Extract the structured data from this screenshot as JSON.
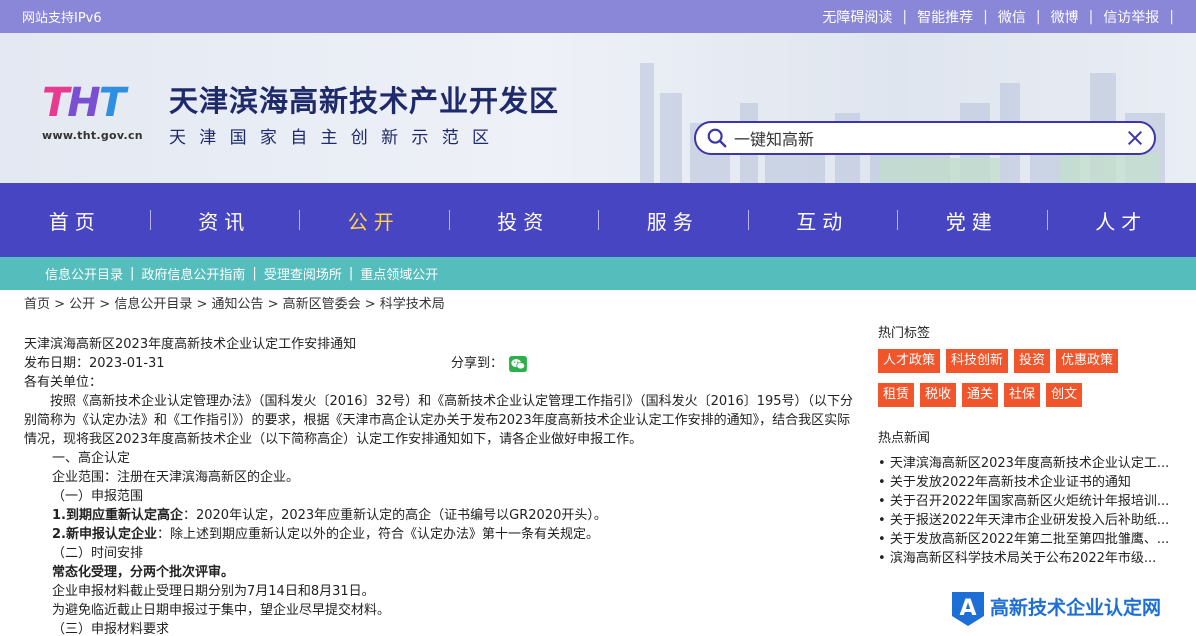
{
  "topbar": {
    "left": "网站支持IPv6",
    "links": [
      "无障碍阅读",
      "智能推荐",
      "微信",
      "微博",
      "信访举报"
    ]
  },
  "header": {
    "logo_mark": "THT",
    "logo_url": "www.tht.gov.cn",
    "title": "天津滨海高新技术产业开发区",
    "subtitle": "天津国家自主创新示范区"
  },
  "search": {
    "value": "一键知高新"
  },
  "nav": {
    "items": [
      "首页",
      "资讯",
      "公开",
      "投资",
      "服务",
      "互动",
      "党建",
      "人才"
    ],
    "active": "公开"
  },
  "subnav": {
    "items": [
      "信息公开目录",
      "政府信息公开指南",
      "受理查阅场所",
      "重点领域公开"
    ]
  },
  "breadcrumb": "首页 > 公开 > 信息公开目录 > 通知公告 > 高新区管委会 > 科学技术局",
  "article": {
    "title": "天津滨海高新区2023年度高新技术企业认定工作安排通知",
    "date_label": "发布日期：",
    "date": "2023-01-31",
    "share_label": "分享到：",
    "greeting": "各有关单位：",
    "intro": "按照《高新技术企业认定管理办法》（国科发火〔2016〕32号）和《高新技术企业认定管理工作指引》（国科发火〔2016〕195号）（以下分别简称为《认定办法》和《工作指引》）的要求，根据《天津市高企认定办关于发布2023年度高新技术企业认定工作安排的通知》，结合我区实际情况，现将我区2023年度高新技术企业（以下简称高企）认定工作安排通知如下，请各企业做好申报工作。",
    "s1": "一、高企认定",
    "scope": "企业范围：注册在天津滨海高新区的企业。",
    "s1_1": "（一）申报范围",
    "item1_bold": "1.到期应重新认定高企",
    "item1_rest": "：2020年认定，2023年应重新认定的高企（证书编号以GR2020开头）。",
    "item2_bold": "2.新申报认定企业",
    "item2_rest": "：除上述到期应重新认定以外的企业，符合《认定办法》第十一条有关规定。",
    "s1_2": "（二）时间安排",
    "schedule_bold": "常态化受理，分两个批次评审。",
    "deadline": "企业申报材料截止受理日期分别为7月14日和8月31日。",
    "advice": "为避免临近截止日期申报过于集中，望企业尽早提交材料。",
    "s1_3": "（三）申报材料要求"
  },
  "sidebar": {
    "tags_title": "热门标签",
    "tags": [
      "人才政策",
      "科技创新",
      "投资",
      "优惠政策",
      "租赁",
      "税收",
      "通关",
      "社保",
      "创文"
    ],
    "news_title": "热点新闻",
    "news": [
      "天津滨海高新区2023年度高新技术企业认定工...",
      "关于发放2022年高新技术企业证书的通知",
      "关于召开2022年国家高新区火炬统计年报培训...",
      "关于报送2022年天津市企业研发投入后补助纸...",
      "关于发放高新区2022年第二批至第四批雏鹰、...",
      "滨海高新区科学技术局关于公布2022年市级..."
    ]
  },
  "watermark": {
    "text": "高新技术企业认定网",
    "badge": "A"
  },
  "colors": {
    "topbar": "#8a86d8",
    "nav": "#4845c3",
    "active": "#ffd24a",
    "subnav": "#56bdbd",
    "tag": "#f0552b"
  }
}
